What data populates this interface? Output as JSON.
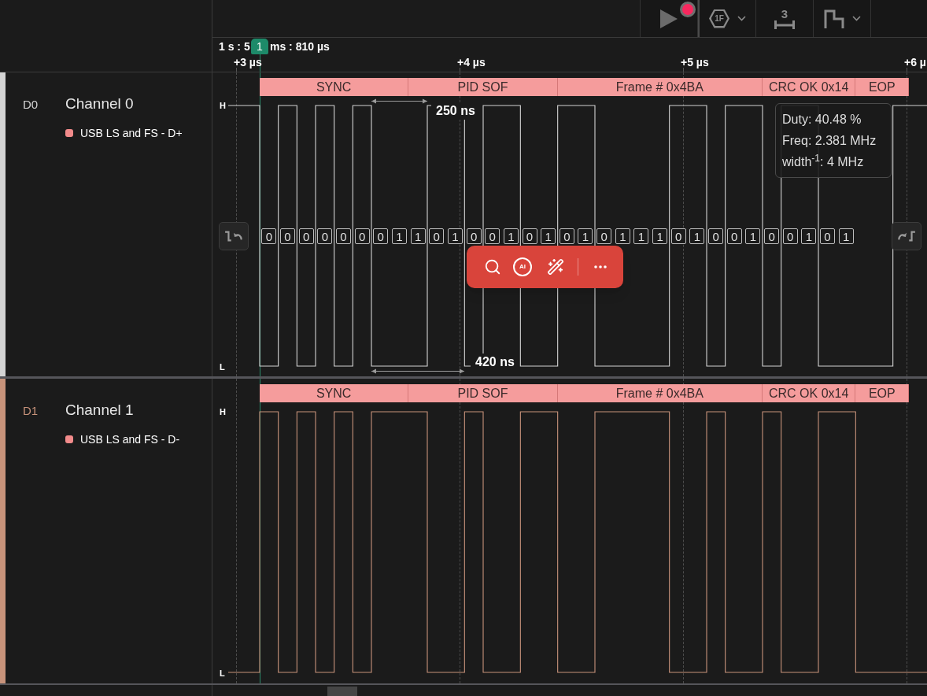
{
  "toolbar": {
    "buttons": [
      {
        "kind": "play"
      },
      {
        "kind": "trigger",
        "glyph": "1F"
      },
      {
        "kind": "measure",
        "glyph": "3"
      },
      {
        "kind": "layout"
      }
    ]
  },
  "ruler": {
    "time_prefix": "1 s : 5",
    "marker": "1",
    "time_suffix": "ms : 810 µs",
    "ticks": [
      "+3 µs",
      "+4 µs",
      "+5 µs",
      "+6 µ"
    ]
  },
  "channels": [
    {
      "id": "D0",
      "name": "Channel 0",
      "color": "#d4d4d4",
      "analyzer": "USB LS and FS - D+",
      "high_label": "H",
      "low_label": "L",
      "edge_buttons": true,
      "frames": [
        "SYNC",
        "PID SOF",
        "Frame # 0x4BA",
        "CRC OK 0x14",
        "EOP"
      ],
      "bits": [
        "0",
        "0",
        "0",
        "0",
        "0",
        "0",
        "0",
        "1",
        "1",
        "0",
        "1",
        "0",
        "0",
        "1",
        "0",
        "1",
        "0",
        "1",
        "0",
        "1",
        "1",
        "1",
        "0",
        "1",
        "0",
        "0",
        "1",
        "0",
        "0",
        "1",
        "0",
        "1"
      ],
      "measurements": [
        "250 ns",
        "420 ns"
      ],
      "tooltip": [
        "Duty: 40.48 %",
        "Freq: 2.381 MHz",
        "width$^{-1}$: 4 MHz"
      ],
      "popup": {
        "ai_label": "AI"
      }
    },
    {
      "id": "D1",
      "name": "Channel 1",
      "color": "#c8937b",
      "analyzer": "USB LS and FS - D-",
      "high_label": "H",
      "low_label": "L",
      "edge_buttons": false,
      "frames": [
        "SYNC",
        "PID SOF",
        "Frame # 0x4BA",
        "CRC OK 0x14",
        "EOP"
      ]
    }
  ]
}
